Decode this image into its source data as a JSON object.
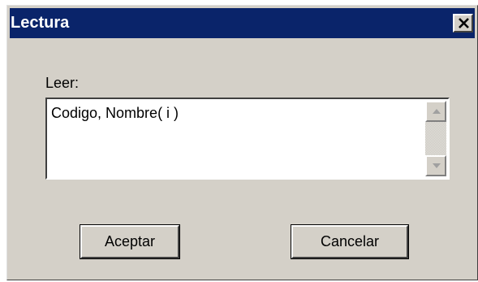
{
  "window": {
    "title": "Lectura",
    "close_icon": "close-x-icon"
  },
  "form": {
    "label": "Leer:",
    "input_value": "Codigo, Nombre( i )"
  },
  "scrollbar": {
    "up_icon": "arrow-up-icon",
    "down_icon": "arrow-down-icon"
  },
  "buttons": {
    "ok_label": "Aceptar",
    "cancel_label": "Cancelar"
  },
  "colors": {
    "titlebar": "#0a246a",
    "face": "#d4d0c8",
    "title_text": "#ffffff"
  }
}
